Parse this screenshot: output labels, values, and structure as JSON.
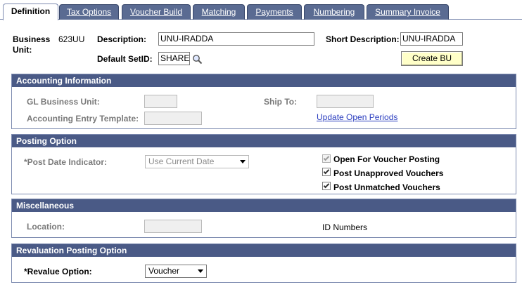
{
  "tabs": [
    {
      "label": "Definition"
    },
    {
      "label": "Tax Options"
    },
    {
      "label": "Voucher Build"
    },
    {
      "label": "Matching"
    },
    {
      "label": "Payments"
    },
    {
      "label": "Numbering"
    },
    {
      "label": "Summary Invoice"
    }
  ],
  "header": {
    "business_unit_label_1": "Business",
    "business_unit_label_2": "Unit:",
    "business_unit_value": "623UU",
    "description_label": "Description:",
    "description_value": "UNU-IRADDA",
    "short_description_label": "Short Description:",
    "short_description_value": "UNU-IRADDA",
    "default_setid_label": "Default SetID:",
    "default_setid_value": "SHARE",
    "create_bu_label": "Create BU"
  },
  "accounting": {
    "title": "Accounting Information",
    "gl_bu_label": "GL Business Unit:",
    "gl_bu_value": "",
    "ship_to_label": "Ship To:",
    "ship_to_value": "",
    "entry_template_label": "Accounting Entry Template:",
    "entry_template_value": "",
    "update_periods_link": "Update Open Periods"
  },
  "posting": {
    "title": "Posting Option",
    "post_date_label": "*Post Date Indicator:",
    "post_date_value": "Use Current Date",
    "open_for_voucher_label": "Open For Voucher Posting",
    "unapproved_label": "Post Unapproved Vouchers",
    "unmatched_label": "Post Unmatched Vouchers",
    "open_for_voucher_checked": true,
    "unapproved_checked": true,
    "unmatched_checked": true
  },
  "misc": {
    "title": "Miscellaneous",
    "location_label": "Location:",
    "location_value": "",
    "id_numbers_label": "ID Numbers"
  },
  "revaluation": {
    "title": "Revaluation Posting Option",
    "revalue_label": "*Revalue Option:",
    "revalue_value": "Voucher"
  },
  "colors": {
    "section_header": "#4a5a86",
    "tab_inactive": "#5a6b92",
    "button_bg": "#ffffc8",
    "link": "#2a3dbf"
  }
}
